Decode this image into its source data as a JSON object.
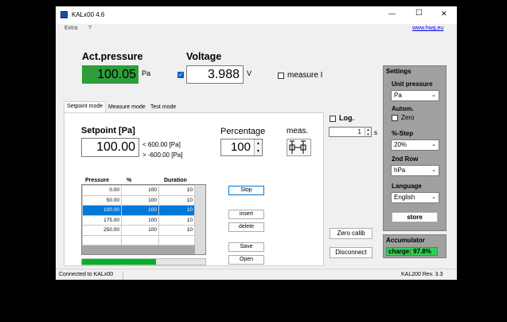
{
  "window": {
    "title": "KALx00 4.6"
  },
  "titlebar": {
    "minimize": "—",
    "maximize": "☐",
    "close": "✕"
  },
  "menu": {
    "items": [
      "Extra",
      "?"
    ],
    "link": "www.hwg.eu"
  },
  "actual": {
    "label": "Act.pressure",
    "value": "100.05",
    "unit": "Pa"
  },
  "voltage": {
    "label": "Voltage",
    "value": "3.988",
    "unit": "V",
    "checked": true
  },
  "measure_i": {
    "label": "measure I"
  },
  "tabs": [
    "Setpoint mode",
    "Measure mode",
    "Test mode"
  ],
  "setpoint": {
    "label": "Setpoint [Pa]",
    "value": "100.00",
    "max": "< 600.00 [Pa]",
    "min": "> -600.00 [Pa]"
  },
  "percentage": {
    "label": "Percentage",
    "value": "100"
  },
  "meas": {
    "label": "meas."
  },
  "log": {
    "label": "Log.",
    "value": "1",
    "unit": "s"
  },
  "table": {
    "headers": [
      "Pressure",
      "%",
      "Duration"
    ],
    "rows": [
      [
        "0.00",
        "100",
        "10"
      ],
      [
        "50.00",
        "100",
        "10"
      ],
      [
        "100.00",
        "100",
        "10"
      ],
      [
        "175.00",
        "100",
        "10"
      ],
      [
        "250.00",
        "100",
        "10"
      ]
    ]
  },
  "progress": {
    "fraction": 0.6
  },
  "buttons": {
    "stop": "Stop",
    "insert": "insert",
    "delete": "delete",
    "save": "Save",
    "open": "Open",
    "zero_calib": "Zero calib",
    "disconnect": "Disconnect"
  },
  "settings": {
    "title": "Settings",
    "unit_label": "Unit pressure",
    "unit_value": "Pa",
    "autom_label": "Autom.",
    "zero_label": "Zero",
    "step_label": "%-Step",
    "step_value": "20%",
    "row2_label": "2nd Row",
    "row2_value": "hPa",
    "lang_label": "Language",
    "lang_value": "English",
    "store": "store"
  },
  "accumulator": {
    "label": "Accumulator",
    "charge": "charge: 97.8%"
  },
  "status": {
    "left": "Connected to KALx00",
    "right": "KAL200 Rev. 3.3"
  },
  "colors": {
    "green_display": "#2e9e3a",
    "accent": "#0078d7",
    "settings_bg": "#a0a0a0",
    "charge_bg": "#33cc55"
  }
}
